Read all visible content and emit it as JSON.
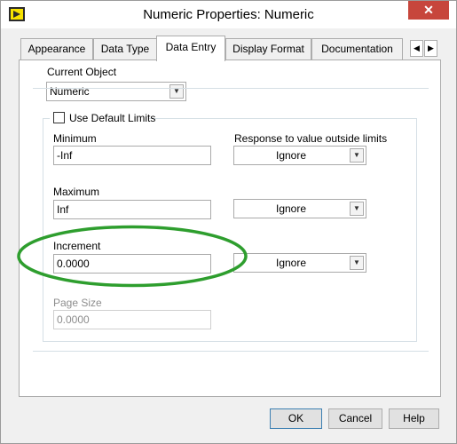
{
  "window": {
    "title": "Numeric Properties: Numeric",
    "close_glyph": "✕"
  },
  "tabs": [
    {
      "label": "Appearance",
      "active": false
    },
    {
      "label": "Data Type",
      "active": false
    },
    {
      "label": "Data Entry",
      "active": true
    },
    {
      "label": "Display Format",
      "active": false
    },
    {
      "label": "Documentation",
      "active": false
    }
  ],
  "tab_scroll": {
    "left_glyph": "◀",
    "right_glyph": "▶"
  },
  "current_object": {
    "label": "Current Object",
    "value": "Numeric"
  },
  "limits": {
    "use_default_label": "Use Default Limits",
    "use_default_checked": false,
    "response_label": "Response to value outside limits",
    "minimum": {
      "label": "Minimum",
      "value": "-Inf",
      "response": "Ignore"
    },
    "maximum": {
      "label": "Maximum",
      "value": "Inf",
      "response": "Ignore"
    },
    "increment": {
      "label": "Increment",
      "value": "0.0000",
      "response": "Ignore"
    },
    "page_size": {
      "label": "Page Size",
      "value": "0.0000"
    }
  },
  "buttons": {
    "ok": "OK",
    "cancel": "Cancel",
    "help": "Help"
  },
  "annotation": {
    "color": "#2e9e2e"
  }
}
